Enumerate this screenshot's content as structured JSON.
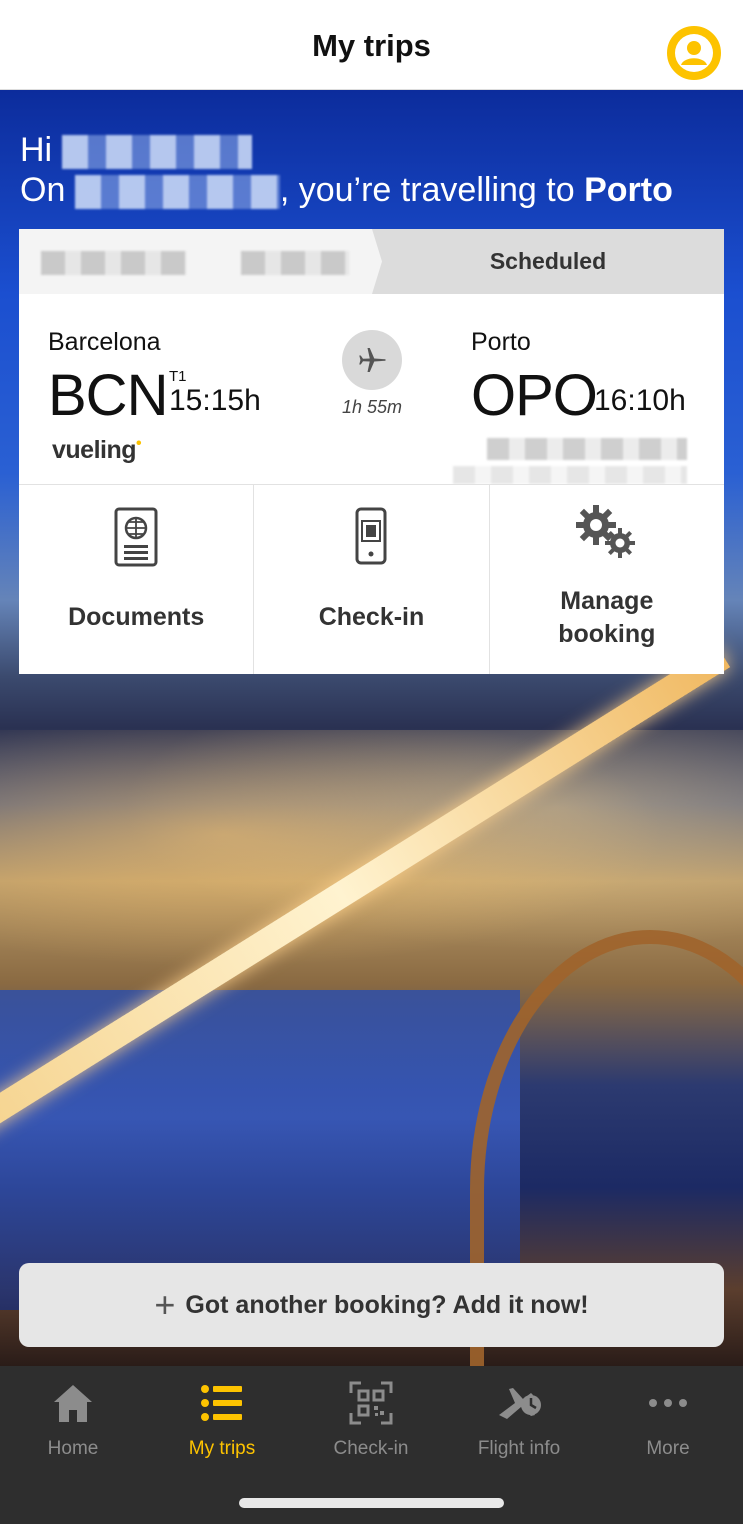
{
  "header": {
    "title": "My trips",
    "profile_icon": "user-circle-icon"
  },
  "greeting": {
    "line1_prefix": "Hi",
    "line2_prefix": "On",
    "line2_suffix": ", you’re travelling to ",
    "destination": "Porto"
  },
  "trip": {
    "status": "Scheduled",
    "origin": {
      "city": "Barcelona",
      "code": "BCN",
      "terminal": "T1",
      "time": "15:15h"
    },
    "destination": {
      "city": "Porto",
      "code": "OPO",
      "time": "16:10h"
    },
    "duration": "1h 55m",
    "airline": "vueling",
    "actions": [
      {
        "label": "Documents",
        "icon": "passport-icon"
      },
      {
        "label": "Check-in",
        "icon": "mobile-boarding-pass-icon"
      },
      {
        "label": "Manage booking",
        "icon": "gears-icon"
      }
    ]
  },
  "add_booking": {
    "label": "Got another booking? Add it now!"
  },
  "tabbar": {
    "accent": "#fdc300",
    "items": [
      {
        "label": "Home",
        "icon": "home-icon"
      },
      {
        "label": "My trips",
        "icon": "list-icon",
        "active": true
      },
      {
        "label": "Check-in",
        "icon": "qr-code-icon"
      },
      {
        "label": "Flight info",
        "icon": "flight-clock-icon"
      },
      {
        "label": "More",
        "icon": "more-icon"
      }
    ]
  }
}
